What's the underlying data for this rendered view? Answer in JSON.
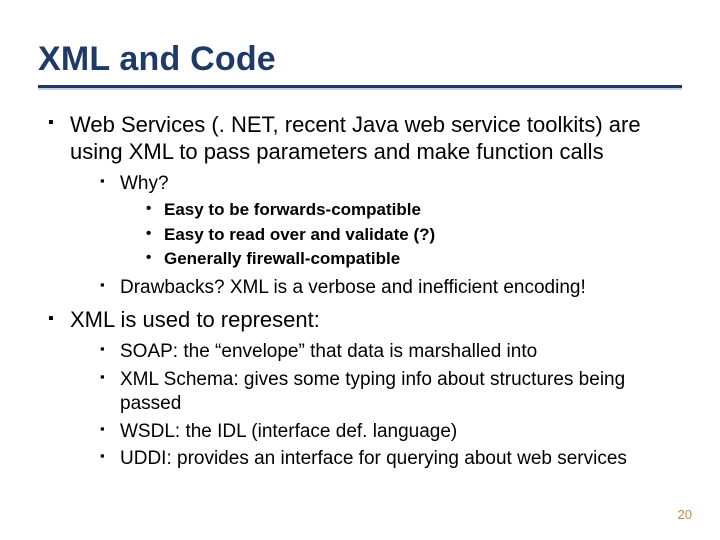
{
  "title": "XML and Code",
  "bullets": {
    "b1": "Web Services (. NET, recent Java web service toolkits) are using XML to pass parameters and make function calls",
    "b1a": "Why?",
    "b1a_i": "Easy to be forwards-compatible",
    "b1a_ii": "Easy to read over and validate (?)",
    "b1a_iii": "Generally firewall-compatible",
    "b1b": "Drawbacks?  XML is a verbose and inefficient encoding!",
    "b2": "XML is used to represent:",
    "b2a": "SOAP:  the “envelope” that data is marshalled into",
    "b2b": "XML Schema:  gives some typing info about structures being passed",
    "b2c": "WSDL:  the IDL (interface def. language)",
    "b2d": "UDDI:  provides an interface for querying about web services"
  },
  "page_number": "20"
}
